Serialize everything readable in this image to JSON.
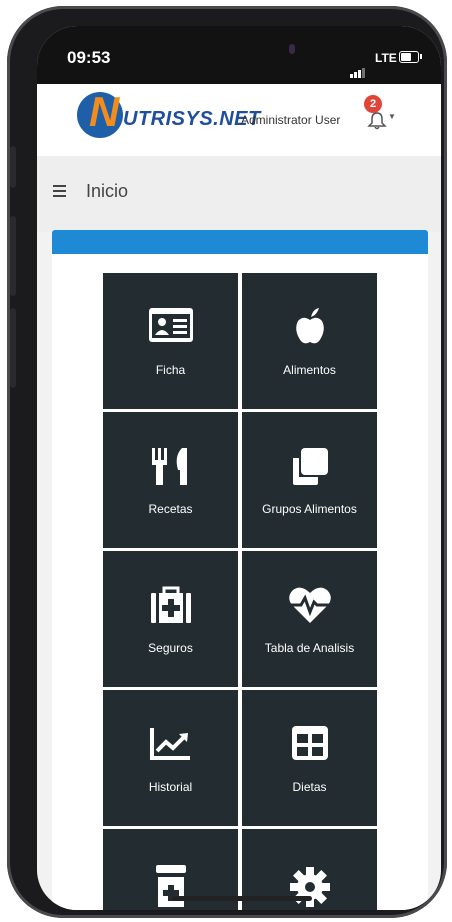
{
  "status_bar": {
    "time": "09:53",
    "network": "LTE"
  },
  "header": {
    "logo_letter": "N",
    "logo_text": "UTRISYS.NET",
    "user_name": "Administrator User",
    "notification_count": "2"
  },
  "breadcrumb": {
    "title": "Inicio"
  },
  "colors": {
    "accent": "#1e8ad6",
    "tile": "#232d31",
    "badge": "#e0453a",
    "logo_blue": "#1f5fa8",
    "logo_orange": "#f28c1a"
  },
  "menu": {
    "items": [
      {
        "label": "Ficha",
        "icon": "id-card-icon"
      },
      {
        "label": "Alimentos",
        "icon": "apple-icon"
      },
      {
        "label": "Recetas",
        "icon": "utensils-icon"
      },
      {
        "label": "Grupos Alimentos",
        "icon": "clone-icon"
      },
      {
        "label": "Seguros",
        "icon": "medkit-icon"
      },
      {
        "label": "Tabla de Analisis",
        "icon": "heartbeat-icon"
      },
      {
        "label": "Historial",
        "icon": "line-chart-icon"
      },
      {
        "label": "Dietas",
        "icon": "table-icon"
      },
      {
        "label": "",
        "icon": "medicine-bottle-icon"
      },
      {
        "label": "",
        "icon": "gear-icon"
      }
    ]
  }
}
